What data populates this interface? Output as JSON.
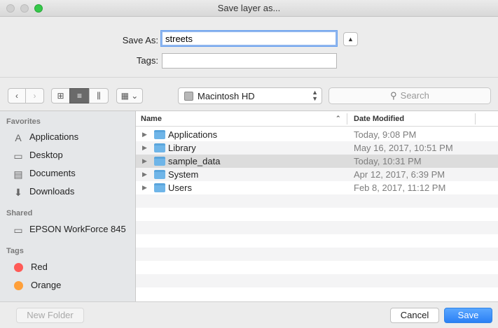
{
  "window": {
    "title": "Save layer as..."
  },
  "form": {
    "saveas_label": "Save As:",
    "saveas_value": "streets",
    "tags_label": "Tags:",
    "tags_value": "",
    "expand_glyph": "▲"
  },
  "toolbar": {
    "back_glyph": "‹",
    "forward_glyph": "›",
    "icon_view_glyph": "⊞",
    "list_view_glyph": "≡",
    "column_view_glyph": "⫼",
    "arrange_glyph": "▦ ⌄",
    "location": "Macintosh HD",
    "location_glyph": "⌃⌄",
    "search_placeholder": "Search"
  },
  "sidebar": {
    "favorites_title": "Favorites",
    "favorites": [
      {
        "label": "Applications",
        "icon": "applications-icon"
      },
      {
        "label": "Desktop",
        "icon": "desktop-icon"
      },
      {
        "label": "Documents",
        "icon": "documents-icon"
      },
      {
        "label": "Downloads",
        "icon": "downloads-icon"
      }
    ],
    "shared_title": "Shared",
    "shared": [
      {
        "label": "EPSON WorkForce 845",
        "icon": "printer-icon"
      }
    ],
    "tags_title": "Tags",
    "tags": [
      {
        "label": "Red",
        "color": "#ff5b57"
      },
      {
        "label": "Orange",
        "color": "#ffa03a"
      }
    ]
  },
  "filelist": {
    "columns": {
      "name": "Name",
      "date": "Date Modified"
    },
    "rows": [
      {
        "name": "Applications",
        "date": "Today, 9:08 PM"
      },
      {
        "name": "Library",
        "date": "May 16, 2017, 10:51 PM"
      },
      {
        "name": "sample_data",
        "date": "Today, 10:31 PM",
        "selected": true
      },
      {
        "name": "System",
        "date": "Apr 12, 2017, 6:39 PM"
      },
      {
        "name": "Users",
        "date": "Feb 8, 2017, 11:12 PM"
      }
    ]
  },
  "buttons": {
    "new_folder": "New Folder",
    "cancel": "Cancel",
    "save": "Save"
  },
  "colors": {
    "accent": "#2b80f5",
    "folder": "#6fb5e8",
    "selection": "#dcdcdc"
  }
}
